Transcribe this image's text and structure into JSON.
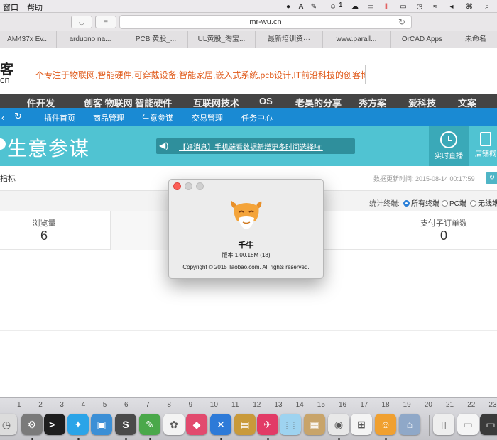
{
  "menubar": {
    "items": [
      "窗口",
      "帮助"
    ],
    "status": {
      "battery_badge": "1"
    }
  },
  "browser": {
    "address": "mr-wu.cn",
    "bookmarks": [
      "AM437x Ev...",
      "arduono na...",
      "PCB 黄股_...",
      "UL黄股_淘宝...",
      "最新培训资···",
      "www.parall...",
      "OrCAD Apps",
      "未命名"
    ]
  },
  "site": {
    "logo_top": "客",
    "logo_bottom": "cn",
    "tagline": "一个专注于物联网,智能硬件,可穿戴设备,智能家居,嵌入式系统,pcb设计,IT前沿科技的创客博客",
    "nav": [
      "件开发",
      "创客 物联网 智能硬件",
      "互联网技术",
      "OS",
      "老昊的分享",
      "秀方案",
      "爱科技",
      "文案"
    ],
    "accent_color": "#e05a1a"
  },
  "plugin": {
    "nav": [
      "插件首页",
      "商品管理",
      "生意参谋",
      "交易管理",
      "任务中心"
    ],
    "active": "生意参谋"
  },
  "banner": {
    "title": "生意参谋",
    "notice": "【好消息】手机端看数据新增更多时间选择啦!",
    "live_label": "实时直播",
    "store_label": "店铺概"
  },
  "content": {
    "indicator_title": "指标",
    "update_time": "数据更新时间: 2015-08-14 00:17:59",
    "filter_label": "统计终端:",
    "terminals": [
      "所有终端",
      "PC端",
      "无线端"
    ],
    "selected_terminal": "所有终端",
    "stats": [
      {
        "title": "浏览量",
        "value": "6"
      },
      {
        "title": "支付子订单数",
        "value": "0"
      }
    ]
  },
  "dialog": {
    "app_name": "千牛",
    "version": "版本 1.00.18M (18)",
    "copyright": "Copyright © 2015 Taobao.com. All rights reserved."
  },
  "dock": {
    "numbers": [
      "1",
      "2",
      "3",
      "4",
      "5",
      "6",
      "7",
      "8",
      "9",
      "10",
      "11",
      "12",
      "13",
      "14",
      "15",
      "16",
      "17",
      "18",
      "19",
      "20",
      "21",
      "22",
      "23"
    ],
    "apps": [
      {
        "name": "clock",
        "color": "#dcdcdc"
      },
      {
        "name": "system-preferences",
        "color": "#7a7a7a"
      },
      {
        "name": "terminal",
        "color": "#1e1e1e"
      },
      {
        "name": "twitter",
        "color": "#2aa4e8"
      },
      {
        "name": "screen-sharing",
        "color": "#3b8fd6"
      },
      {
        "name": "sublime-text",
        "color": "#4a4a4a"
      },
      {
        "name": "evernote",
        "color": "#4aa84a"
      },
      {
        "name": "photos",
        "color": "#f3f3f3"
      },
      {
        "name": "sketchbook",
        "color": "#e24a6e"
      },
      {
        "name": "xcode",
        "color": "#2d7ad8"
      },
      {
        "name": "preview",
        "color": "#c99a3a"
      },
      {
        "name": "messenger",
        "color": "#e23b66"
      },
      {
        "name": "maps",
        "color": "#9ed3f0"
      },
      {
        "name": "archive",
        "color": "#c8a46a"
      },
      {
        "name": "chrome",
        "color": "#e8e8e8"
      },
      {
        "name": "windows",
        "color": "#f4f4f4"
      },
      {
        "name": "qianniu",
        "color": "#f0a030"
      },
      {
        "name": "finder-tool",
        "color": "#8fa8c8"
      },
      {
        "name": "document",
        "color": "#eeeeee"
      },
      {
        "name": "drive",
        "color": "#f5f5f5"
      },
      {
        "name": "trash",
        "color": "#3a3a3a"
      }
    ]
  }
}
